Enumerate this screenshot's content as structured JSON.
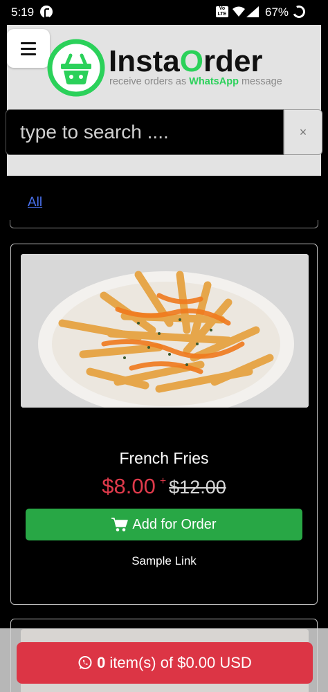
{
  "status_bar": {
    "time": "5:19",
    "volte": "VoLTE",
    "battery": "67%"
  },
  "header": {
    "brand_prefix": "Insta",
    "brand_o": "O",
    "brand_suffix": "rder",
    "tagline_start": "receive orders as ",
    "tagline_brand": "WhatsApp",
    "tagline_end": " message",
    "accent_color": "#2bd15a"
  },
  "search": {
    "placeholder": "type to search ....",
    "value": "",
    "clear_label": "×"
  },
  "categories": {
    "items": [
      "All"
    ]
  },
  "products": [
    {
      "name": "French Fries",
      "price": "$8.00",
      "plus": "+",
      "old_price": "$12.00",
      "add_label": "Add for Order",
      "link_label": "Sample Link"
    }
  ],
  "cart": {
    "count": "0",
    "text": "item(s) of $0.00 USD",
    "color": "#dc3545"
  }
}
